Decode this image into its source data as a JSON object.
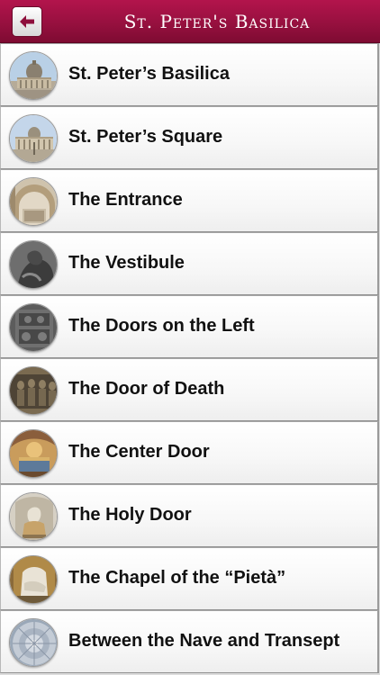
{
  "header": {
    "title": "St. Peter's Basilica",
    "back_icon": "back-arrow-icon",
    "accent_color": "#97103f"
  },
  "items": [
    {
      "label": "St. Peter’s Basilica",
      "icon": "basilica-thumbnail"
    },
    {
      "label": "St. Peter’s Square",
      "icon": "square-thumbnail"
    },
    {
      "label": "The Entrance",
      "icon": "entrance-thumbnail"
    },
    {
      "label": "The Vestibule",
      "icon": "vestibule-thumbnail"
    },
    {
      "label": "The Doors on the Left",
      "icon": "doors-left-thumbnail"
    },
    {
      "label": "The Door of Death",
      "icon": "door-of-death-thumbnail"
    },
    {
      "label": "The Center Door",
      "icon": "center-door-thumbnail"
    },
    {
      "label": "The Holy Door",
      "icon": "holy-door-thumbnail"
    },
    {
      "label": "The Chapel of the “Pietà”",
      "icon": "pieta-chapel-thumbnail"
    },
    {
      "label": "Between the Nave and Transept",
      "icon": "nave-dome-thumbnail"
    }
  ]
}
